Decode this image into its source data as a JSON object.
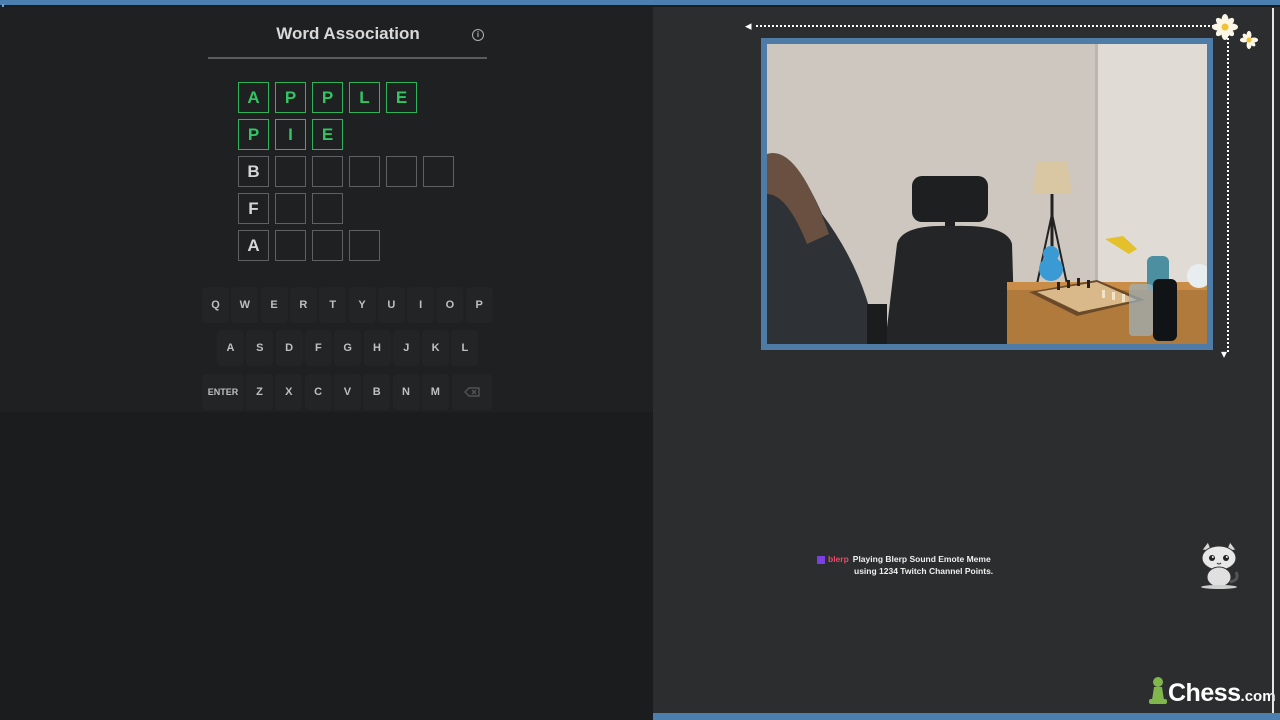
{
  "game": {
    "title": "Word Association",
    "rows": [
      {
        "letters": [
          "A",
          "P",
          "P",
          "L",
          "E"
        ],
        "tiles": 5,
        "solved": true
      },
      {
        "letters": [
          "P",
          "I",
          "E"
        ],
        "tiles": 3,
        "solved": true
      },
      {
        "letters": [
          "B"
        ],
        "tiles": 6,
        "solved": false
      },
      {
        "letters": [
          "F"
        ],
        "tiles": 3,
        "solved": false
      },
      {
        "letters": [
          "A"
        ],
        "tiles": 4,
        "solved": false
      }
    ],
    "keyboard": {
      "row1": [
        "Q",
        "W",
        "E",
        "R",
        "T",
        "Y",
        "U",
        "I",
        "O",
        "P"
      ],
      "row2": [
        "A",
        "S",
        "D",
        "F",
        "G",
        "H",
        "J",
        "K",
        "L"
      ],
      "row3": [
        "ENTER",
        "Z",
        "X",
        "C",
        "V",
        "B",
        "N",
        "M"
      ],
      "backspace_icon": "backspace-icon"
    }
  },
  "stream": {
    "alert_brand": "blerp",
    "alert_line1": "Playing Blerp Sound Emote Meme",
    "alert_line2": "using 1234 Twitch Channel Points.",
    "logo_main": "Chess",
    "logo_suffix": ".com"
  },
  "colors": {
    "accent": "#4a7fb0",
    "solved": "#33c463",
    "panel": "#1b1c1e"
  }
}
